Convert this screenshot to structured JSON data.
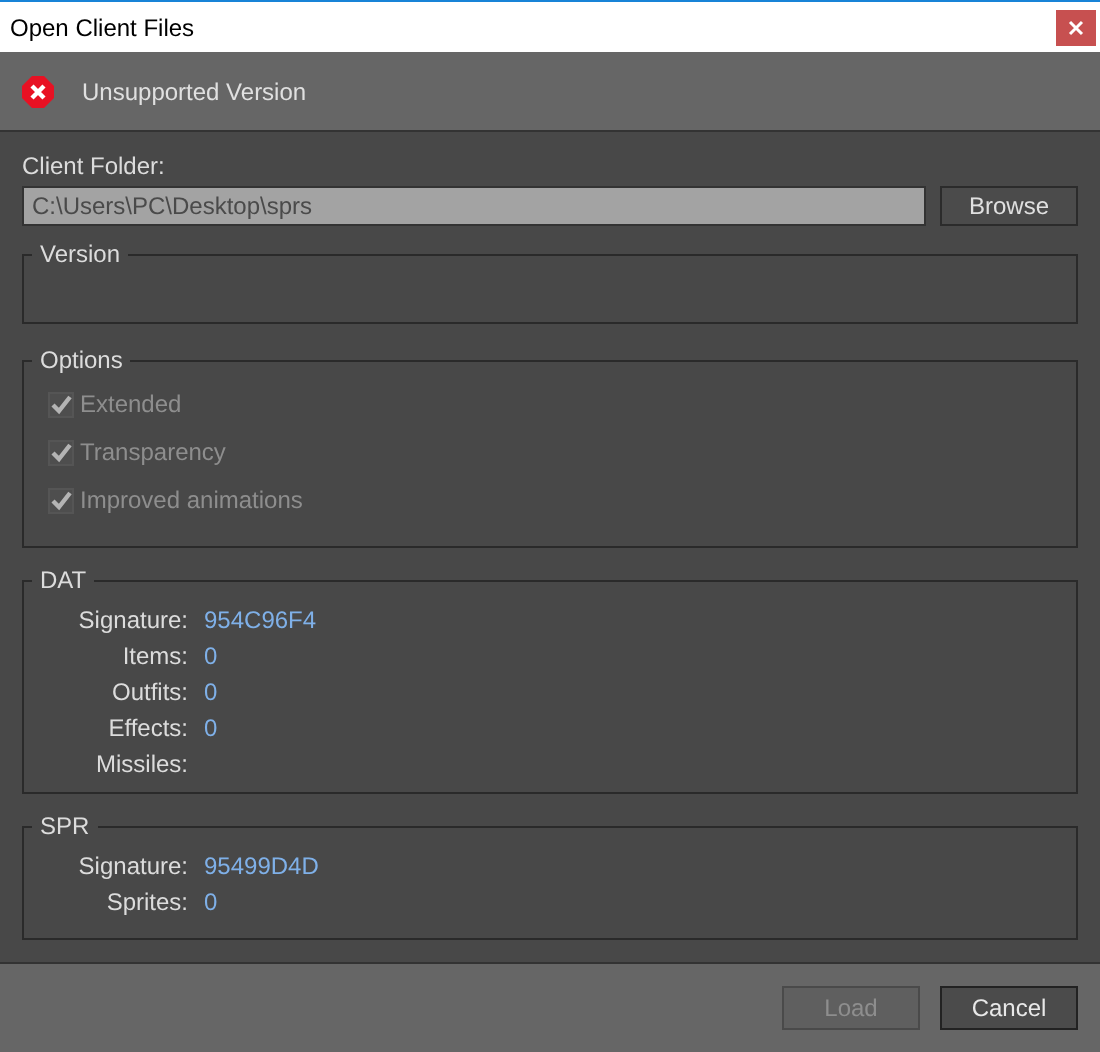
{
  "window": {
    "title": "Open Client Files"
  },
  "status": {
    "kind": "error",
    "message": "Unsupported Version"
  },
  "client_folder": {
    "label": "Client Folder:",
    "value": "C:\\Users\\PC\\Desktop\\sprs",
    "button": "Browse"
  },
  "version": {
    "title": "Version"
  },
  "options": {
    "title": "Options",
    "items": [
      {
        "label": "Extended",
        "checked": true,
        "disabled": true
      },
      {
        "label": "Transparency",
        "checked": true,
        "disabled": true
      },
      {
        "label": "Improved animations",
        "checked": true,
        "disabled": true
      }
    ]
  },
  "dat": {
    "title": "DAT",
    "rows": [
      {
        "label": "Signature:",
        "value": "954C96F4"
      },
      {
        "label": "Items:",
        "value": "0"
      },
      {
        "label": "Outfits:",
        "value": "0"
      },
      {
        "label": "Effects:",
        "value": "0"
      },
      {
        "label": "Missiles:"
      }
    ]
  },
  "spr": {
    "title": "SPR",
    "rows": [
      {
        "label": "Signature:",
        "value": "95499D4D"
      },
      {
        "label": "Sprites:",
        "value": "0"
      }
    ]
  },
  "buttons": [
    {
      "label": "Load",
      "disabled": true
    },
    {
      "label": "Cancel",
      "disabled": false
    }
  ]
}
